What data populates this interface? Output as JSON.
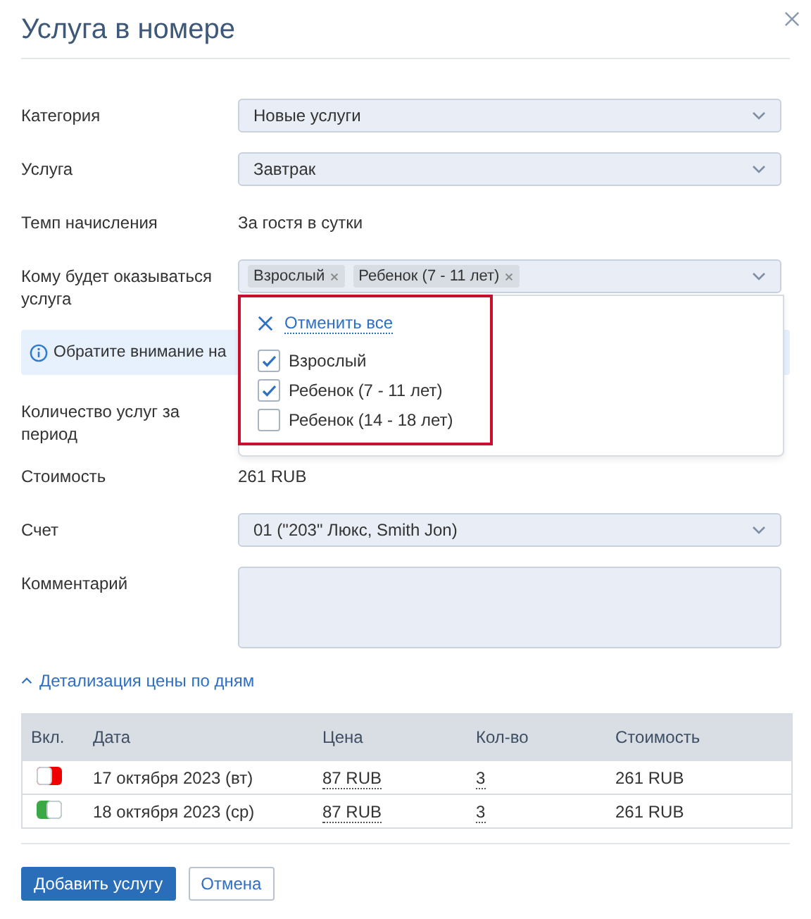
{
  "dialog": {
    "title": "Услуга в номере"
  },
  "form": [
    {
      "kind": "select",
      "label": "Категория",
      "value": "Новые услуги"
    },
    {
      "kind": "select",
      "label": "Услуга",
      "value": "Завтрак"
    },
    {
      "kind": "text",
      "label": "Темп начисления",
      "value": "За гостя в сутки"
    },
    {
      "kind": "multiselect",
      "label": "Кому будет оказываться услуга",
      "tags": [
        "Взрослый",
        "Ребенок (7 - 11 лет)"
      ],
      "dropdown": {
        "clear_all": "Отменить все",
        "options": [
          {
            "label": "Взрослый",
            "checked": true
          },
          {
            "label": "Ребенок (7 - 11 лет)",
            "checked": true
          },
          {
            "label": "Ребенок (14 - 18 лет)",
            "checked": false
          }
        ]
      }
    },
    {
      "kind": "notice",
      "text": "Обратите внимание на"
    },
    {
      "kind": "hidden",
      "label": "Количество услуг за период"
    },
    {
      "kind": "text",
      "label": "Стоимость",
      "value": "261 RUB"
    },
    {
      "kind": "select",
      "label": "Счет",
      "value": "01 (\"203\" Люкс, Smith Jon)"
    },
    {
      "kind": "textarea",
      "label": "Комментарий"
    }
  ],
  "details_toggle": {
    "label": "Детализация цены по дням",
    "expanded": true
  },
  "table": {
    "columns": [
      "Вкл.",
      "Дата",
      "Цена",
      "Кол-во",
      "Стоимость"
    ],
    "rows": [
      {
        "on": false,
        "date": "17 октября 2023 (вт)",
        "price": "87 RUB",
        "qty": "3",
        "cost": "261 RUB"
      },
      {
        "on": true,
        "date": "18 октября 2023 (ср)",
        "price": "87 RUB",
        "qty": "3",
        "cost": "261 RUB"
      }
    ]
  },
  "buttons": [
    {
      "kind": "primary",
      "label": "Добавить услугу"
    },
    {
      "kind": "secondary",
      "label": "Отмена"
    }
  ]
}
